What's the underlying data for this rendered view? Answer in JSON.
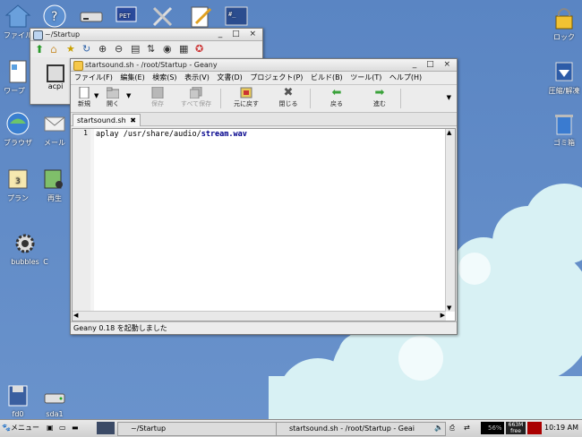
{
  "desktop": {
    "icons_top": [
      {
        "label": "ファイル",
        "icon": "home-folder-icon"
      },
      {
        "label": "",
        "icon": "help-icon"
      },
      {
        "label": "",
        "icon": "drive-icon"
      },
      {
        "label": "PET",
        "icon": "pet-package-icon"
      },
      {
        "label": "",
        "icon": "tools-icon"
      },
      {
        "label": "",
        "icon": "edit-icon"
      },
      {
        "label": "",
        "icon": "terminal-icon"
      }
    ],
    "icons_left": [
      {
        "label": "ワープ",
        "icon": "word-processor-icon"
      },
      {
        "label": "ブラウザ",
        "icon": "browser-icon"
      },
      {
        "label": "メール",
        "icon": "mail-icon"
      },
      {
        "label": "プラン",
        "icon": "calendar-icon"
      },
      {
        "label": "再生",
        "icon": "music-icon"
      },
      {
        "label": "bubbles",
        "icon": "gear-icon"
      },
      {
        "label": "C",
        "icon": "partial-icon"
      },
      {
        "label": "fd0",
        "icon": "floppy-icon"
      },
      {
        "label": "sda1",
        "icon": "disk-icon"
      }
    ],
    "icons_right": [
      {
        "label": "ロック",
        "icon": "lock-icon"
      },
      {
        "label": "圧縮/解凍",
        "icon": "archive-icon"
      },
      {
        "label": "ゴミ箱",
        "icon": "trash-icon"
      }
    ]
  },
  "filer_window": {
    "title": "~/Startup",
    "item_label": "acpi"
  },
  "geany": {
    "title": "startsound.sh - /root/Startup - Geany",
    "menu": [
      "ファイル(F)",
      "編集(E)",
      "検索(S)",
      "表示(V)",
      "文書(D)",
      "プロジェクト(P)",
      "ビルド(B)",
      "ツール(T)",
      "ヘルプ(H)"
    ],
    "toolbar": {
      "new": "新規",
      "open": "開く",
      "save": "保存",
      "save_all": "すべて保存",
      "revert": "元に戻す",
      "close": "閉じる",
      "back": "戻る",
      "forward": "進む"
    },
    "tab_label": "startsound.sh",
    "line_number": "1",
    "code_prefix": "aplay /usr/share/audio/",
    "code_file": "stream.wav",
    "status_text": "Geany 0.18 を起動しました"
  },
  "taskbar": {
    "menu_label": "メニュー",
    "task_filer": "~/Startup",
    "task_geany": "startsound.sh - /root/Startup - Geai",
    "cpu_label": "56%",
    "mem_value": "663M",
    "mem_label": "free",
    "clock": "10:19 AM"
  }
}
